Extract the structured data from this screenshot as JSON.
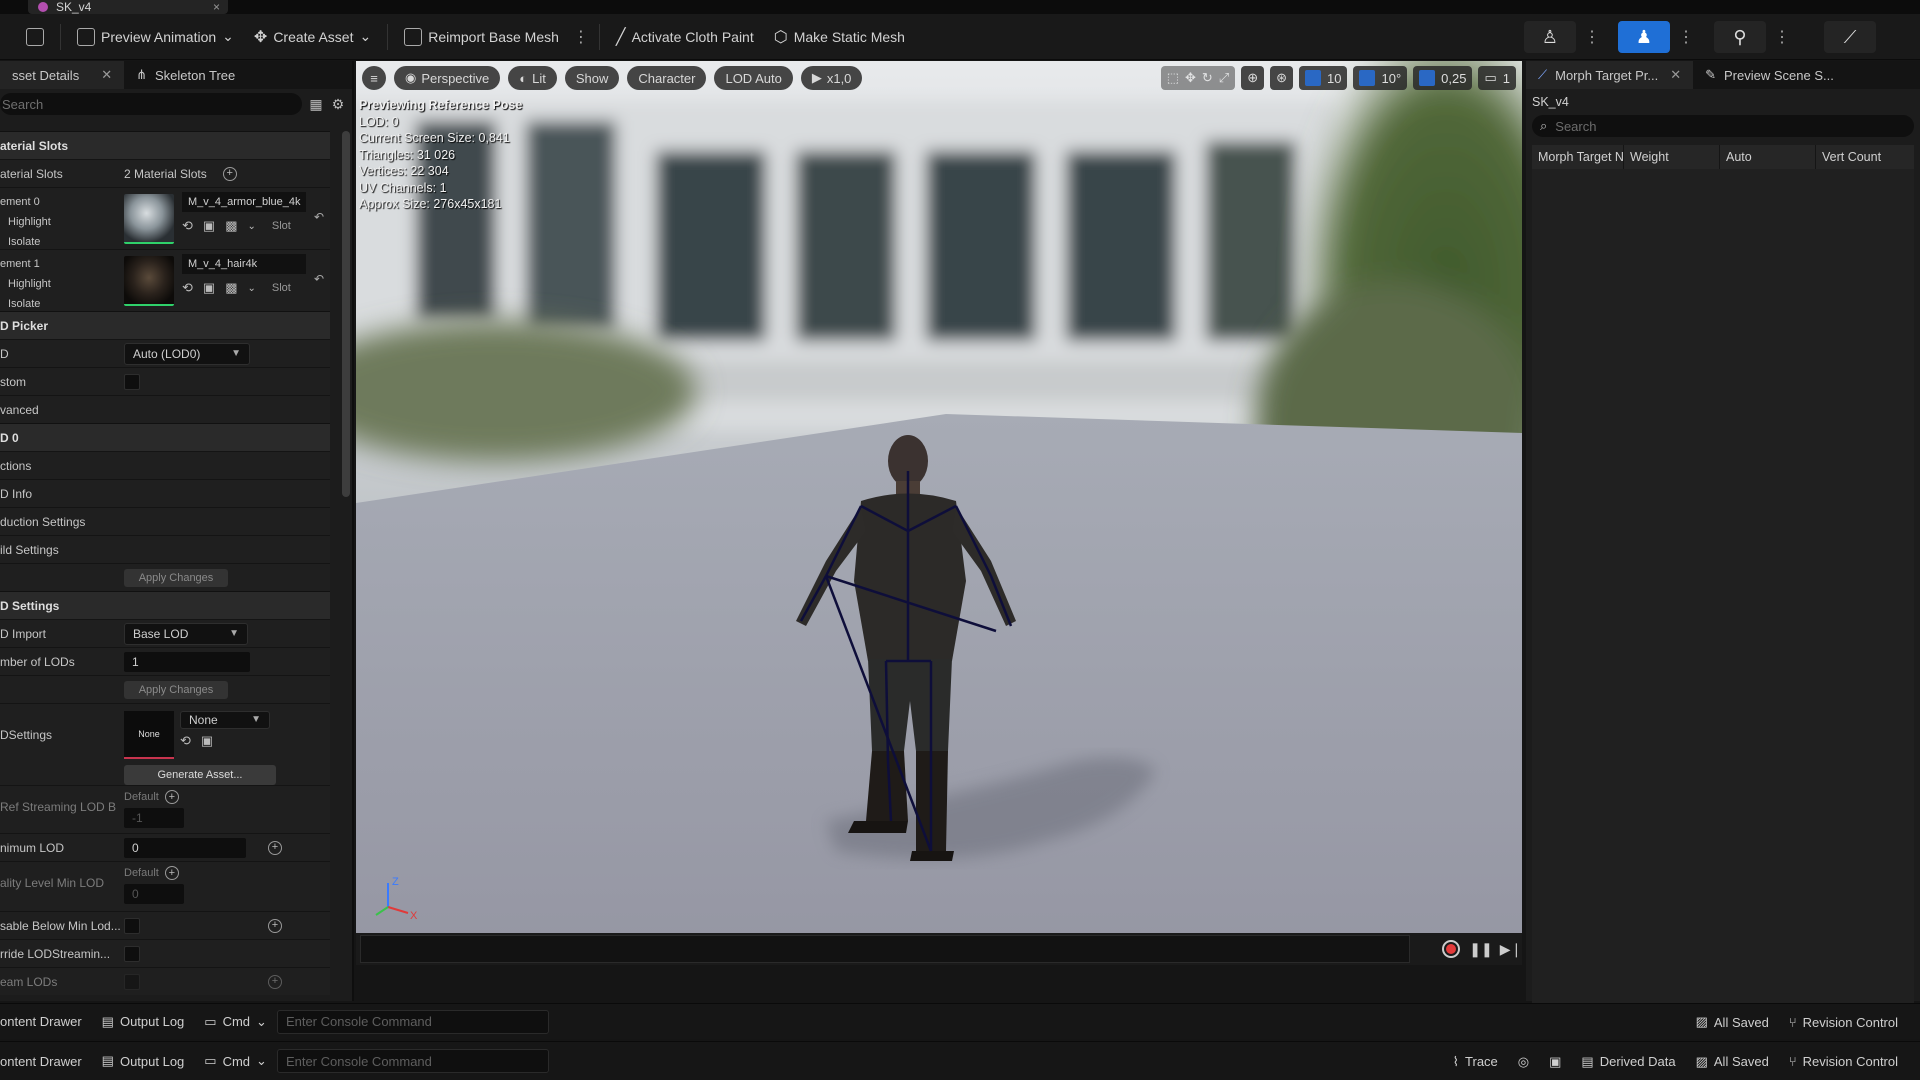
{
  "window": {
    "tab_title": "SK_v4",
    "close": "×"
  },
  "toolbar": {
    "preview_animation": "Preview Animation",
    "create_asset": "Create Asset",
    "reimport": "Reimport Base Mesh",
    "activate_cloth": "Activate Cloth Paint",
    "make_static": "Make Static Mesh"
  },
  "left_panel": {
    "tab_details": "sset Details",
    "tab_skeleton": "Skeleton Tree",
    "search_placeholder": "Search",
    "material_slots_header": "aterial Slots",
    "material_slots_label": "aterial Slots",
    "material_slots_value": "2 Material Slots",
    "element0": {
      "label": "ement 0",
      "highlight": "Highlight",
      "isolate": "Isolate",
      "material": "M_v_4_armor_blue_4k",
      "slot": "Slot"
    },
    "element1": {
      "label": "ement 1",
      "highlight": "Highlight",
      "isolate": "Isolate",
      "material": "M_v_4_hair4k",
      "slot": "Slot"
    },
    "lod_picker_header": "D Picker",
    "lod_label": "D",
    "lod_value": "Auto (LOD0)",
    "custom_label": "stom",
    "advanced_label": "vanced",
    "lod0_header": "D 0",
    "sections_label": "ctions",
    "lod_info_label": "D Info",
    "reduction_label": "duction Settings",
    "build_label": "ild Settings",
    "apply_changes": "Apply Changes",
    "lod_settings_header": "D Settings",
    "lod_import_label": "D Import",
    "lod_import_value": "Base LOD",
    "num_lods_label": "mber of LODs",
    "num_lods_value": "1",
    "apply_changes2": "Apply Changes",
    "lodsettings_label": "DSettings",
    "none_thumb": "None",
    "none_dropdown": "None",
    "generate_asset": "Generate Asset...",
    "ref_streaming_label": "Ref Streaming LOD B",
    "ref_streaming_default": "Default",
    "ref_streaming_value": "-1",
    "min_lod_label": "nimum LOD",
    "min_lod_value": "0",
    "quality_min_label": "ality Level Min LOD",
    "quality_default": "Default",
    "quality_value": "0",
    "disable_below_label": "sable Below Min Lod...",
    "override_label": "rride LODStreamin...",
    "stream_lods_label": "eam LODs"
  },
  "viewport": {
    "perspective": "Perspective",
    "lit": "Lit",
    "show": "Show",
    "character": "Character",
    "lod_auto": "LOD Auto",
    "speed": "x1,0",
    "grid_snap": "10",
    "rot_snap": "10°",
    "scale_snap": "0,25",
    "cam_speed": "1",
    "info": {
      "line1": "Previewing Reference Pose",
      "line2": "LOD: 0",
      "line3": "Current Screen Size: 0,841",
      "line4": "Triangles: 31 026",
      "line5": "Vertices: 22 304",
      "line6": "UV Channels: 1",
      "line7": "Approx Size: 276x45x181"
    },
    "axis_z": "Z",
    "axis_x": "X"
  },
  "right_panel": {
    "tab_morph": "Morph Target Pr...",
    "tab_preview": "Preview Scene S...",
    "asset_name": "SK_v4",
    "search_placeholder": "Search",
    "columns": [
      "Morph Target N",
      "Weight",
      "Auto",
      "Vert Count"
    ]
  },
  "statusbar1": {
    "content_drawer": "ontent Drawer",
    "output_log": "Output Log",
    "cmd": "Cmd",
    "console_placeholder": "Enter Console Command",
    "all_saved": "All Saved",
    "revision_control": "Revision Control"
  },
  "statusbar2": {
    "content_drawer": "ontent Drawer",
    "output_log": "Output Log",
    "cmd": "Cmd",
    "console_placeholder": "Enter Console Command",
    "trace": "Trace",
    "derived_data": "Derived Data",
    "all_saved": "All Saved",
    "revision_control": "Revision Control"
  },
  "colors": {
    "accent_blue": "#1f6fd6",
    "slot_green": "#2fd16a",
    "record_red": "#e23a3a"
  }
}
